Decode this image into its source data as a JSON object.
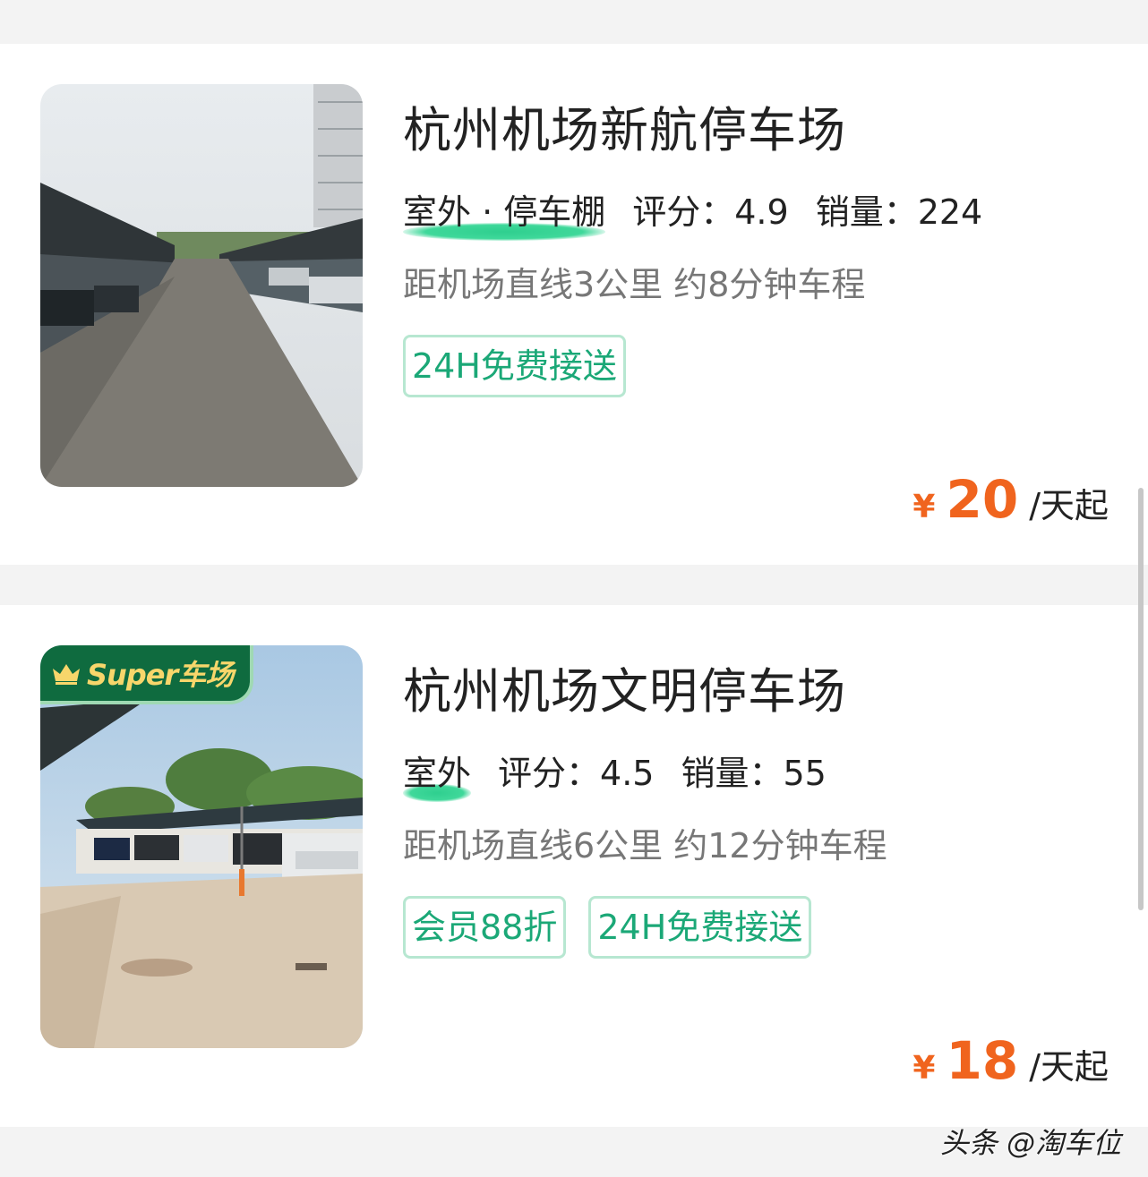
{
  "listings": [
    {
      "name": "杭州机场新航停车场",
      "type": "室外 · 停车棚",
      "rating": "评分：4.9",
      "sales": "销量：224",
      "distance": "距机场直线3公里 约8分钟车程",
      "badges": [
        "24H免费接送"
      ],
      "currency": "¥",
      "price": "20",
      "price_unit": "/天起",
      "super_label": ""
    },
    {
      "name": "杭州机场文明停车场",
      "type": "室外",
      "rating": "评分：4.5",
      "sales": "销量：55",
      "distance": "距机场直线6公里 约12分钟车程",
      "badges": [
        "会员88折",
        "24H免费接送"
      ],
      "currency": "¥",
      "price": "18",
      "price_unit": "/天起",
      "super_label": "Super车场"
    }
  ],
  "watermark": "头条 @淘车位",
  "colors": {
    "accent_green": "#1ba877",
    "price_orange": "#f0641e",
    "badge_border": "#b7e7d1",
    "super_bg": "#0f6b3f"
  }
}
